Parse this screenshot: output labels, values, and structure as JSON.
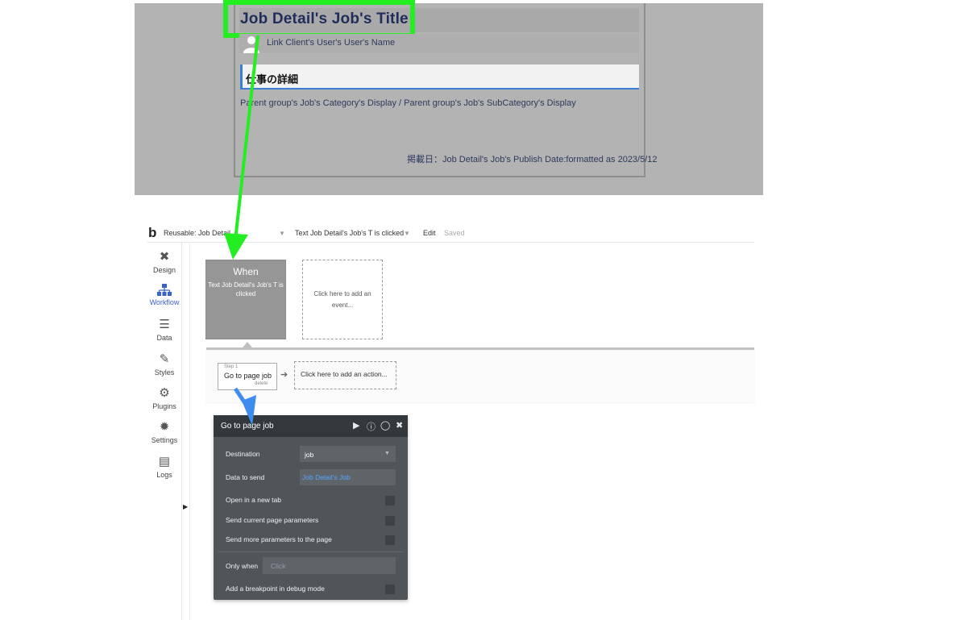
{
  "preview": {
    "job_title": "Job Detail's Job's Title",
    "client_name": "Link Client's User's User's Name",
    "section_title": "仕事の詳細",
    "category_line": "Parent group's Job's Category's Display  /  Parent group's Job's SubCategory's Display",
    "publish_line": "掲載日：Job Detail's Job's Publish Date:formatted as 2023/5/12"
  },
  "topbar": {
    "logo": "b",
    "reusable": "Reusable: Job Detail",
    "event": "Text Job Detail's Job's T is clicked",
    "edit": "Edit",
    "saved": "Saved"
  },
  "sidebar": {
    "items": [
      {
        "label": "Design",
        "icon": "design-tools-icon"
      },
      {
        "label": "Workflow",
        "icon": "workflow-icon"
      },
      {
        "label": "Data",
        "icon": "database-icon"
      },
      {
        "label": "Styles",
        "icon": "brush-icon"
      },
      {
        "label": "Plugins",
        "icon": "plugins-icon"
      },
      {
        "label": "Settings",
        "icon": "gear-icon"
      },
      {
        "label": "Logs",
        "icon": "document-icon"
      }
    ],
    "active": "Workflow"
  },
  "workflow": {
    "when_title": "When",
    "when_event": "Text Job Detail's Job's T is clicked",
    "add_event": "Click here to add an event...",
    "step_number": "Step 1",
    "step_label": "Go to page job",
    "step_delete": "delete",
    "add_action": "Click here to add an action..."
  },
  "panel": {
    "title": "Go to page job",
    "destination_label": "Destination",
    "destination_value": "job",
    "data_label": "Data to send",
    "data_value": "Job Detail's Job",
    "open_new_tab": "Open in a new tab",
    "send_current": "Send current page parameters",
    "send_more": "Send more parameters to the page",
    "only_when_label": "Only when",
    "only_when_placeholder": "Click",
    "breakpoint": "Add a breakpoint in debug mode"
  },
  "colors": {
    "highlight": "#22ee22",
    "arrow_green": "#22ee22",
    "arrow_blue": "#3d8cf0",
    "panel_bg": "#50555a",
    "accent_blue": "#3a62c8"
  }
}
